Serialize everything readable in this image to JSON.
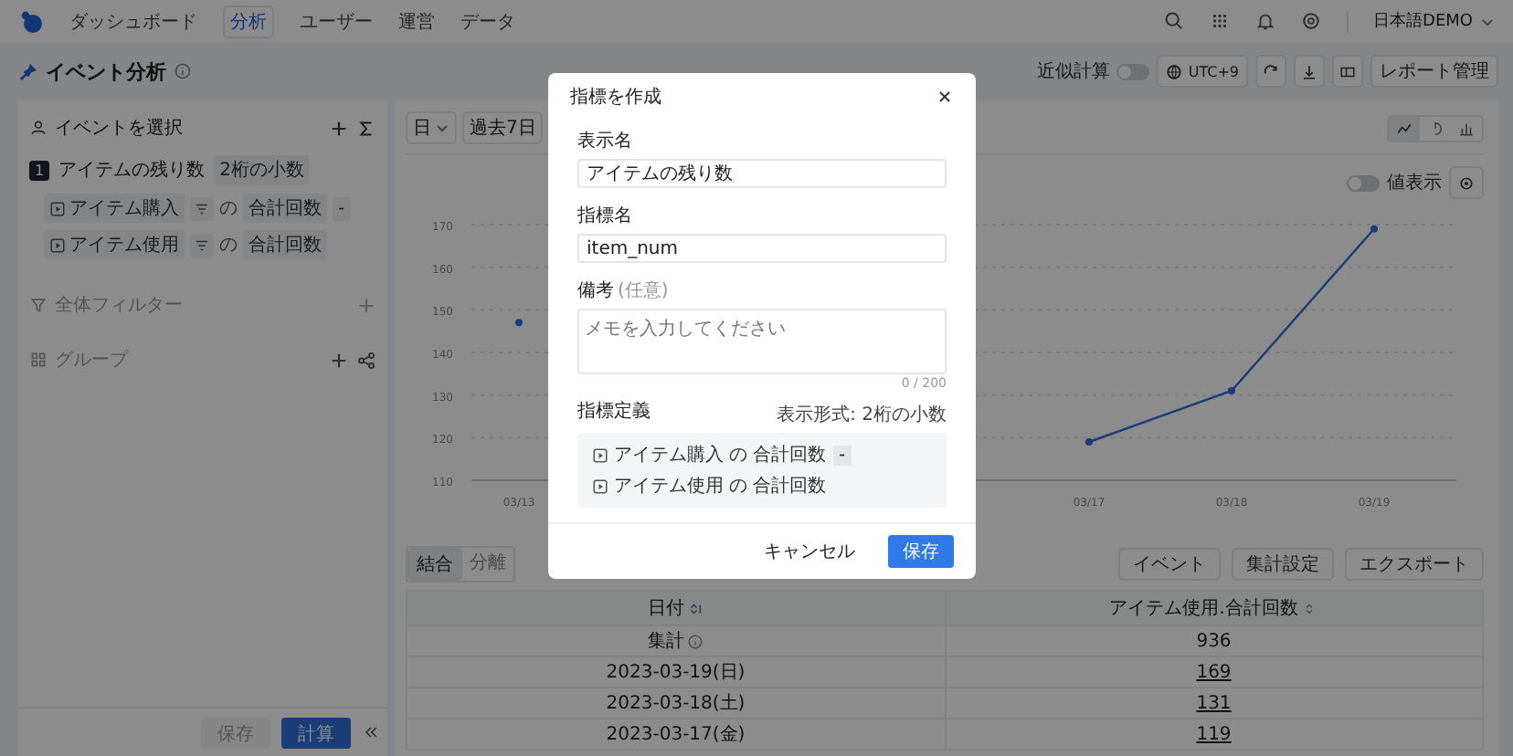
{
  "nav": {
    "items": [
      {
        "label": "ダッシュボード",
        "selected": false
      },
      {
        "label": "分析",
        "selected": true
      },
      {
        "label": "ユーザー",
        "selected": false
      },
      {
        "label": "運営",
        "selected": false
      },
      {
        "label": "データ",
        "selected": false
      }
    ],
    "user": "日本語DEMO"
  },
  "header": {
    "title": "イベント分析",
    "approx": {
      "label": "近似計算",
      "on": false
    },
    "timezone": "UTC+9",
    "report_button": "レポート管理"
  },
  "left": {
    "events_title": "イベントを選択",
    "metric": {
      "index": "1",
      "name": "アイテムの残り数",
      "format": "2桁の小数",
      "terms": [
        {
          "event": "アイテム購入",
          "of": "の",
          "agg": "合計回数",
          "op": "-"
        },
        {
          "event": "アイテム使用",
          "of": "の",
          "agg": "合計回数"
        }
      ]
    },
    "filter_title": "全体フィルター",
    "group_title": "グループ",
    "buttons": [
      {
        "label": "保存",
        "kind": "secondary",
        "disabled": true
      },
      {
        "label": "計算",
        "kind": "primary",
        "disabled": false
      }
    ]
  },
  "toolbar": {
    "granularity": "日",
    "range": "過去7日",
    "chart_types": [
      {
        "kind": "line",
        "selected": true
      },
      {
        "kind": "pie",
        "selected": false
      },
      {
        "kind": "bar",
        "selected": false
      }
    ]
  },
  "value_display": {
    "label": "値表示",
    "on": false
  },
  "chart_data": {
    "type": "line",
    "categories": [
      "03/13",
      null,
      null,
      null,
      "03/17",
      "03/18",
      "03/19"
    ],
    "values": [
      147,
      null,
      null,
      null,
      119,
      131,
      169
    ],
    "ylim": [
      110,
      170
    ],
    "yticks": [
      110,
      120,
      130,
      140,
      150,
      160,
      170
    ],
    "grid": true,
    "marker": true
  },
  "view_tabs": [
    {
      "label": "結合",
      "selected": true
    },
    {
      "label": "分離",
      "selected": false
    }
  ],
  "actions": [
    "イベント",
    "集計設定",
    "エクスポート"
  ],
  "table": {
    "columns": [
      "日付",
      "アイテム使用.合計回数"
    ],
    "rows": [
      {
        "date": "集計",
        "value": "936",
        "kind": "total"
      },
      {
        "date": "2023-03-19(日)",
        "value": "169",
        "kind": "day"
      },
      {
        "date": "2023-03-18(土)",
        "value": "131",
        "kind": "day"
      },
      {
        "date": "2023-03-17(金)",
        "value": "119",
        "kind": "day"
      }
    ]
  },
  "modal": {
    "title": "指標を作成",
    "fields": [
      {
        "label": "表示名",
        "value": "アイテムの残り数"
      },
      {
        "label": "指標名",
        "value": "item_num"
      }
    ],
    "note": {
      "label": "備考",
      "hint": "(任意)",
      "placeholder": "メモを入力してください",
      "counter": "0 / 200"
    },
    "definition": {
      "label": "指標定義",
      "format": "表示形式: 2桁の小数",
      "terms": [
        {
          "event": "アイテム購入",
          "of": "の",
          "agg": "合計回数",
          "op": "-"
        },
        {
          "event": "アイテム使用",
          "of": "の",
          "agg": "合計回数"
        }
      ]
    },
    "buttons": [
      {
        "label": "キャンセル",
        "kind": "secondary"
      },
      {
        "label": "保存",
        "kind": "primary"
      }
    ]
  }
}
